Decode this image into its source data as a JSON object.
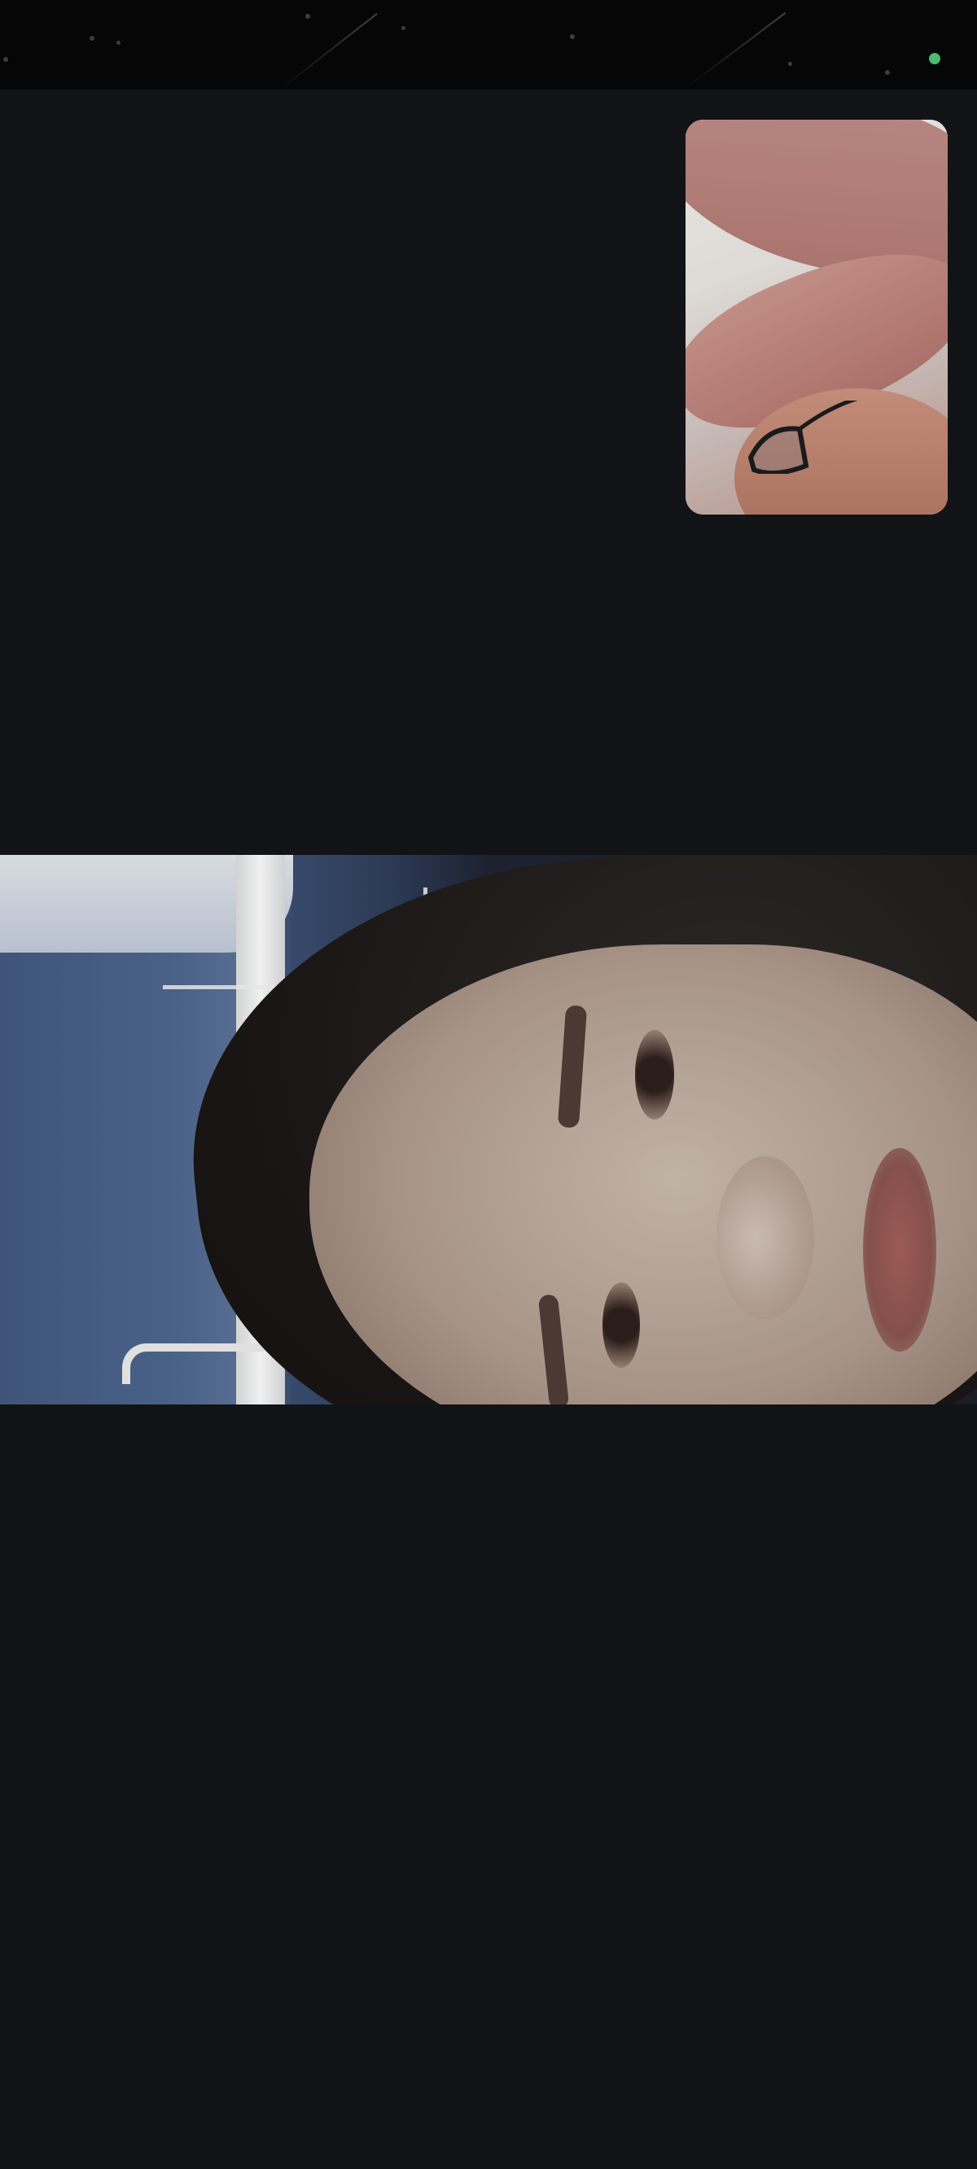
{
  "app": {
    "screen": "video-call",
    "background_color": "#121316"
  },
  "status_bar": {
    "privacy_indicator_color": "#4cbb6c",
    "privacy_indicator": "camera-in-use-indicator"
  },
  "self_view": {
    "description_icon": "self-camera-preview"
  },
  "remote_video": {
    "description_icon": "remote-participant-video"
  }
}
